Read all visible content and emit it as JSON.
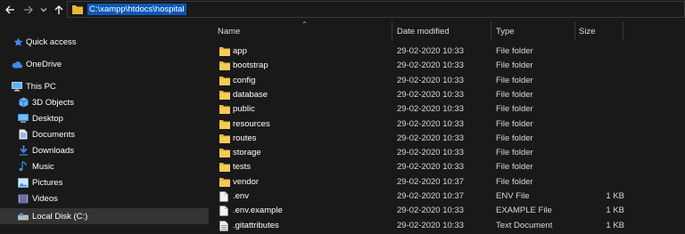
{
  "address": {
    "path": "C:\\xampp\\htdocs\\hospital"
  },
  "sidebar": {
    "items": [
      {
        "label": "Quick access",
        "icon": "star-icon"
      },
      {
        "label": "OneDrive",
        "icon": "cloud-icon"
      },
      {
        "label": "This PC",
        "icon": "computer-icon"
      },
      {
        "label": "3D Objects",
        "icon": "cube-icon"
      },
      {
        "label": "Desktop",
        "icon": "desktop-icon"
      },
      {
        "label": "Documents",
        "icon": "document-icon"
      },
      {
        "label": "Downloads",
        "icon": "download-icon"
      },
      {
        "label": "Music",
        "icon": "music-icon"
      },
      {
        "label": "Pictures",
        "icon": "picture-icon"
      },
      {
        "label": "Videos",
        "icon": "video-icon"
      },
      {
        "label": "Local Disk (C:)",
        "icon": "drive-icon"
      }
    ]
  },
  "columns": {
    "name": "Name",
    "date": "Date modified",
    "type": "Type",
    "size": "Size"
  },
  "files": [
    {
      "name": "app",
      "date": "29-02-2020 10:33",
      "type": "File folder",
      "size": "",
      "icon": "folder-icon"
    },
    {
      "name": "bootstrap",
      "date": "29-02-2020 10:33",
      "type": "File folder",
      "size": "",
      "icon": "folder-icon"
    },
    {
      "name": "config",
      "date": "29-02-2020 10:33",
      "type": "File folder",
      "size": "",
      "icon": "folder-icon"
    },
    {
      "name": "database",
      "date": "29-02-2020 10:33",
      "type": "File folder",
      "size": "",
      "icon": "folder-icon"
    },
    {
      "name": "public",
      "date": "29-02-2020 10:33",
      "type": "File folder",
      "size": "",
      "icon": "folder-icon"
    },
    {
      "name": "resources",
      "date": "29-02-2020 10:33",
      "type": "File folder",
      "size": "",
      "icon": "folder-icon"
    },
    {
      "name": "routes",
      "date": "29-02-2020 10:33",
      "type": "File folder",
      "size": "",
      "icon": "folder-icon"
    },
    {
      "name": "storage",
      "date": "29-02-2020 10:33",
      "type": "File folder",
      "size": "",
      "icon": "folder-icon"
    },
    {
      "name": "tests",
      "date": "29-02-2020 10:33",
      "type": "File folder",
      "size": "",
      "icon": "folder-icon"
    },
    {
      "name": "vendor",
      "date": "29-02-2020 10:37",
      "type": "File folder",
      "size": "",
      "icon": "folder-icon"
    },
    {
      "name": ".env",
      "date": "29-02-2020 10:37",
      "type": "ENV File",
      "size": "1 KB",
      "icon": "file-icon"
    },
    {
      "name": ".env.example",
      "date": "29-02-2020 10:33",
      "type": "EXAMPLE File",
      "size": "1 KB",
      "icon": "file-icon"
    },
    {
      "name": ".gitattributes",
      "date": "29-02-2020 10:33",
      "type": "Text Document",
      "size": "1 KB",
      "icon": "text-file-icon"
    }
  ],
  "colors": {
    "background": "#191919",
    "selection": "#0a58b8",
    "folder": "#e8b739",
    "sidebar_selected": "#333333"
  }
}
